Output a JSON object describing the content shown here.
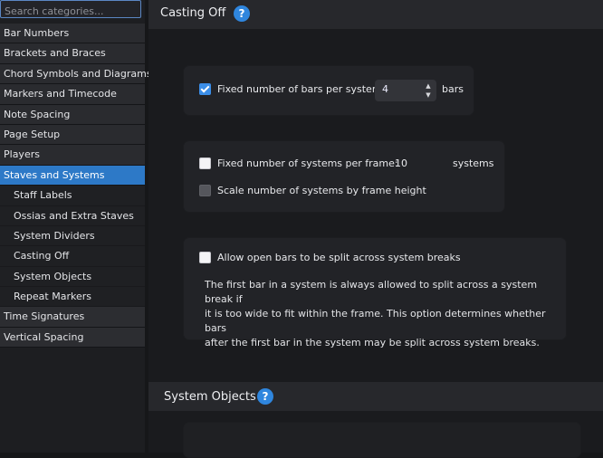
{
  "sidebar": {
    "search_placeholder": "Search categories...",
    "items": [
      {
        "label": "Bar Numbers",
        "level": 0
      },
      {
        "label": "Brackets and Braces",
        "level": 0
      },
      {
        "label": "Chord Symbols and Diagrams",
        "level": 0
      },
      {
        "label": "Markers and Timecode",
        "level": 0
      },
      {
        "label": "Note Spacing",
        "level": 0
      },
      {
        "label": "Page Setup",
        "level": 0
      },
      {
        "label": "Players",
        "level": 0
      },
      {
        "label": "Staves and Systems",
        "level": 0,
        "active": true
      },
      {
        "label": "Staff Labels",
        "level": 1
      },
      {
        "label": "Ossias and Extra Staves",
        "level": 1
      },
      {
        "label": "System Dividers",
        "level": 1
      },
      {
        "label": "Casting Off",
        "level": 1
      },
      {
        "label": "System Objects",
        "level": 1
      },
      {
        "label": "Repeat Markers",
        "level": 1
      },
      {
        "label": "Time Signatures",
        "level": 0
      },
      {
        "label": "Vertical Spacing",
        "level": 0
      }
    ]
  },
  "casting_off": {
    "title": "Casting Off",
    "help_icon": "?",
    "fixed_bars": {
      "label": "Fixed number of bars per system:",
      "checked": true,
      "value": "4",
      "unit": "bars"
    },
    "fixed_systems": {
      "label": "Fixed number of systems per frame:",
      "checked": false,
      "value": "10",
      "unit": "systems"
    },
    "scale_systems": {
      "label": "Scale number of systems by frame height",
      "checked": false,
      "enabled": false
    },
    "allow_split": {
      "label": "Allow open bars to be split across system breaks",
      "checked": false,
      "description_lines": [
        "The first bar in a system is always allowed to split across a system break if",
        "it is too wide to fit within the frame. This option determines whether bars",
        "after the first bar in the system may be split across system breaks."
      ]
    }
  },
  "system_objects": {
    "title": "System Objects",
    "help_icon": "?"
  },
  "colors": {
    "accent": "#2d79c7",
    "help": "#2f86de",
    "background": "#161719"
  }
}
